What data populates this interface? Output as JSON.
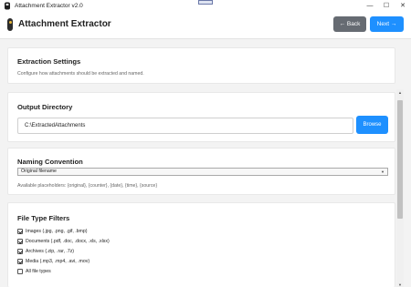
{
  "window": {
    "title": "Attachment Extractor v2.0",
    "controls": [
      "—",
      "☐",
      "✕"
    ]
  },
  "header": {
    "title": "Attachment Extractor",
    "back_label": "← Back",
    "next_label": "Next →"
  },
  "extraction": {
    "title": "Extraction Settings",
    "description": "Configure how attachments should be extracted and named."
  },
  "output": {
    "title": "Output Directory",
    "path": "C:\\ExtractedAttachments",
    "browse_label": "Browse"
  },
  "naming": {
    "title": "Naming Convention",
    "selected": "Original filename",
    "placeholders_note": "Available placeholders: {original}, {counter}, {date}, {time}, {source}"
  },
  "filters": {
    "title": "File Type Filters",
    "items": [
      {
        "label": "Images (.jpg, .png, .gif, .bmp)",
        "checked": true
      },
      {
        "label": "Documents (.pdf, .doc, .docx, .xls, .xlsx)",
        "checked": true
      },
      {
        "label": "Archives (.zip, .rar, .7z)",
        "checked": true
      },
      {
        "label": "Media (.mp3, .mp4, .avi, .mov)",
        "checked": true
      },
      {
        "label": "All file types",
        "checked": false
      }
    ]
  },
  "colors": {
    "accent": "#1e90ff",
    "secondary_button": "#666b72",
    "background": "#f3f3f3"
  },
  "icons": {
    "app": "app-logo-icon",
    "dropdown": "chevron-down-icon",
    "scroll_up": "arrow-up-icon",
    "scroll_down": "arrow-down-icon"
  }
}
